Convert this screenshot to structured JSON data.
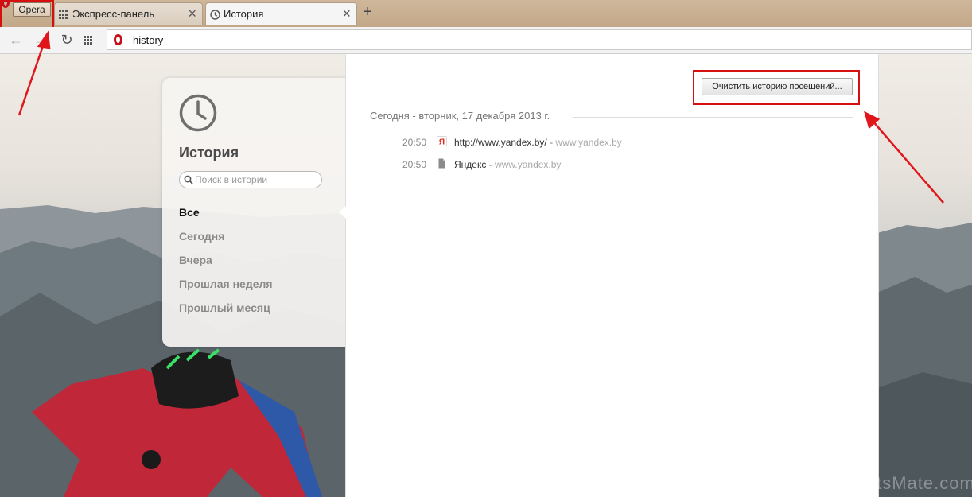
{
  "window": {
    "menu_label": "Opera"
  },
  "tabs": [
    {
      "label": "Экспресс-панель",
      "icon": "speed-dial-grid-icon",
      "active": false
    },
    {
      "label": "История",
      "icon": "clock-icon",
      "active": true
    }
  ],
  "new_tab": {
    "label": "+"
  },
  "toolbar": {
    "back": "←",
    "forward": "→",
    "reload": "↻",
    "url": "history"
  },
  "sidebar": {
    "title": "История",
    "search_placeholder": "Поиск в истории",
    "filters": [
      {
        "label": "Все",
        "selected": true
      },
      {
        "label": "Сегодня",
        "selected": false
      },
      {
        "label": "Вчера",
        "selected": false
      },
      {
        "label": "Прошлая неделя",
        "selected": false
      },
      {
        "label": "Прошлый месяц",
        "selected": false
      }
    ]
  },
  "main": {
    "clear_button": "Очистить историю посещений...",
    "date_heading": "Сегодня - вторник, 17 декабря 2013 г.",
    "entries": [
      {
        "time": "20:50",
        "title": "http://www.yandex.by/",
        "separator": "-",
        "domain": "www.yandex.by",
        "icon": "yandex-favicon-icon"
      },
      {
        "time": "20:50",
        "title": "Яндекс",
        "separator": "-",
        "domain": "www.yandex.by",
        "icon": "page-icon"
      }
    ]
  },
  "watermark": "NetsMate.com",
  "colors": {
    "highlight_red": "#d60f0f",
    "opera_red": "#c8101a",
    "tabbar": "#c9b091"
  }
}
